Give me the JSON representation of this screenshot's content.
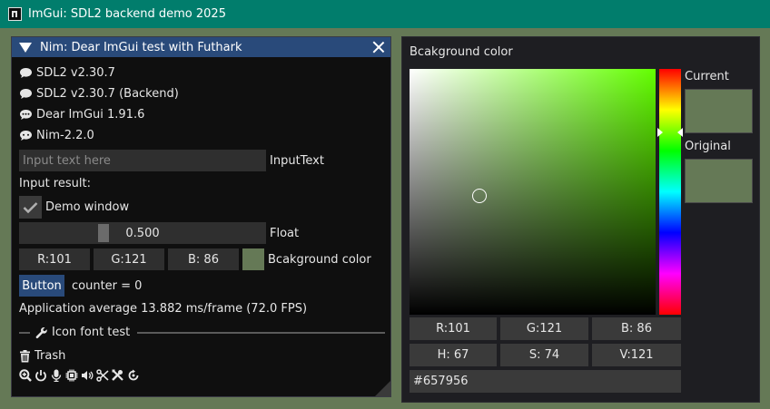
{
  "os_window": {
    "title": "ImGui: SDL2 backend demo 2025"
  },
  "demo_window": {
    "title": "Nim: Dear ImGui test with Futhark",
    "versions": [
      "SDL2 v2.30.7",
      "SDL2 v2.30.7 (Backend)",
      "Dear ImGui 1.91.6",
      "Nim-2.2.0"
    ],
    "input_text": {
      "placeholder": "Input text here",
      "label": "InputText"
    },
    "input_result_label": "Input result:",
    "demo_checkbox": {
      "label": "Demo window",
      "checked": true
    },
    "float_slider": {
      "value": "0.500",
      "label": "Float",
      "fraction": 0.5
    },
    "color_edit": {
      "r": "R:101",
      "g": "G:121",
      "b": "B: 86",
      "label": "Bcakground color",
      "color": "#657956"
    },
    "button": {
      "label": "Button",
      "counter": "counter = 0"
    },
    "fps_text": "Application average 13.882 ms/frame (72.0 FPS)",
    "icon_font_section": {
      "label": "Icon font test"
    },
    "trash_label": "Trash",
    "icon_names": [
      "search-plus-icon",
      "power-icon",
      "microphone-icon",
      "chip-icon",
      "volume-icon",
      "scissors-icon",
      "tools-icon",
      "rotate-icon"
    ]
  },
  "color_picker": {
    "title": "Bcakground color",
    "current_label": "Current",
    "original_label": "Original",
    "current_color": "#657956",
    "original_color": "#657956",
    "rgb": {
      "r": "R:101",
      "g": "G:121",
      "b": "B: 86"
    },
    "hsv": {
      "h": "H: 67",
      "s": "S: 74",
      "v": "V:121"
    },
    "hex": "#657956",
    "hue_color": "#63ff00"
  }
}
